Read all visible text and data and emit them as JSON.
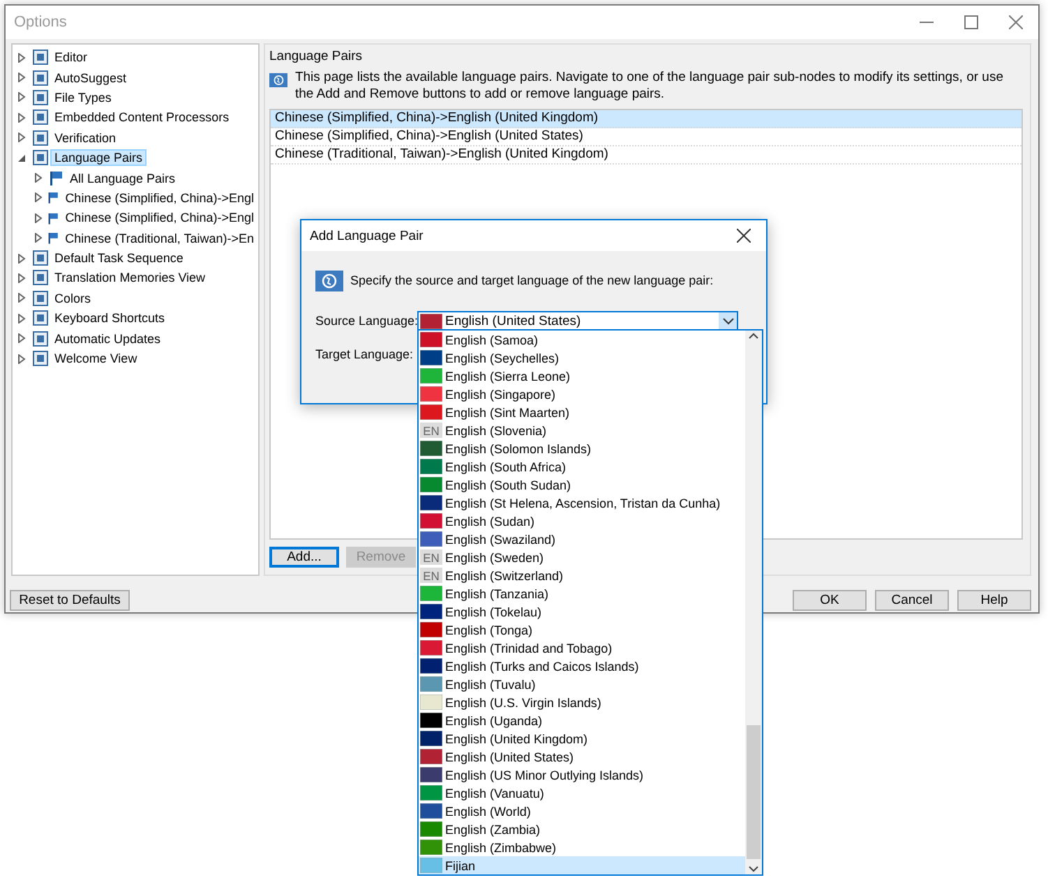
{
  "window": {
    "title": "Options"
  },
  "tree": [
    {
      "label": "Editor",
      "expanded": false,
      "selected": false
    },
    {
      "label": "AutoSuggest",
      "expanded": false,
      "selected": false
    },
    {
      "label": "File Types",
      "expanded": false,
      "selected": false
    },
    {
      "label": "Embedded Content Processors",
      "expanded": false,
      "selected": false
    },
    {
      "label": "Verification",
      "expanded": false,
      "selected": false
    },
    {
      "label": "Language Pairs",
      "expanded": true,
      "selected": true,
      "children": [
        {
          "label": "All Language Pairs",
          "expanded": false,
          "selected": false
        },
        {
          "label": "Chinese (Simplified, China)->Engl",
          "expanded": false,
          "selected": false
        },
        {
          "label": "Chinese (Simplified, China)->Engl",
          "expanded": false,
          "selected": false
        },
        {
          "label": "Chinese (Traditional, Taiwan)->En",
          "expanded": false,
          "selected": false
        }
      ]
    },
    {
      "label": "Default Task Sequence",
      "expanded": false,
      "selected": false
    },
    {
      "label": "Translation Memories View",
      "expanded": false,
      "selected": false
    },
    {
      "label": "Colors",
      "expanded": false,
      "selected": false
    },
    {
      "label": "Keyboard Shortcuts",
      "expanded": false,
      "selected": false
    },
    {
      "label": "Automatic Updates",
      "expanded": false,
      "selected": false
    },
    {
      "label": "Welcome View",
      "expanded": false,
      "selected": false
    }
  ],
  "page": {
    "heading": "Language Pairs",
    "description": "This page lists the available language pairs. Navigate to one of the language pair sub-nodes to modify its settings, or use the Add and Remove buttons to add or remove language pairs.",
    "pairs": [
      {
        "label": "Chinese (Simplified, China)->English (United Kingdom)",
        "selected": true
      },
      {
        "label": "Chinese (Simplified, China)->English (United States)",
        "selected": false
      },
      {
        "label": "Chinese (Traditional, Taiwan)->English (United Kingdom)",
        "selected": false
      }
    ],
    "buttons": [
      {
        "label": "Add...",
        "disabled": false,
        "focused": true
      },
      {
        "label": "Remove",
        "disabled": true,
        "focused": false
      }
    ]
  },
  "footer": {
    "reset": "Reset to Defaults",
    "buttons": [
      "OK",
      "Cancel",
      "Help"
    ]
  },
  "dialog": {
    "title": "Add Language Pair",
    "description": "Specify the source and target language of the new language pair:",
    "source_label": "Source Language:",
    "source_value": "English (United States)",
    "target_label": "Target Language:",
    "options": [
      {
        "label": "English (Samoa)",
        "kind": "flag",
        "color": "#ce1126",
        "selected": false
      },
      {
        "label": "English (Seychelles)",
        "kind": "flag",
        "color": "#003f87",
        "selected": false
      },
      {
        "label": "English (Sierra Leone)",
        "kind": "flag",
        "color": "#1eb53a",
        "selected": false
      },
      {
        "label": "English (Singapore)",
        "kind": "flag",
        "color": "#ef3340",
        "selected": false
      },
      {
        "label": "English (Sint Maarten)",
        "kind": "flag",
        "color": "#dc171d",
        "selected": false
      },
      {
        "label": "English (Slovenia)",
        "kind": "badge",
        "badge": "EN",
        "selected": false
      },
      {
        "label": "English (Solomon Islands)",
        "kind": "flag",
        "color": "#215b33",
        "selected": false
      },
      {
        "label": "English (South Africa)",
        "kind": "flag",
        "color": "#007a4d",
        "selected": false
      },
      {
        "label": "English (South Sudan)",
        "kind": "flag",
        "color": "#078930",
        "selected": false
      },
      {
        "label": "English (St Helena, Ascension, Tristan da Cunha)",
        "kind": "flag",
        "color": "#0a2b7a",
        "selected": false
      },
      {
        "label": "English (Sudan)",
        "kind": "flag",
        "color": "#d21034",
        "selected": false
      },
      {
        "label": "English (Swaziland)",
        "kind": "flag",
        "color": "#3e5eb9",
        "selected": false
      },
      {
        "label": "English (Sweden)",
        "kind": "badge",
        "badge": "EN",
        "selected": false
      },
      {
        "label": "English (Switzerland)",
        "kind": "badge",
        "badge": "EN",
        "selected": false
      },
      {
        "label": "English (Tanzania)",
        "kind": "flag",
        "color": "#1eb53b",
        "selected": false
      },
      {
        "label": "English (Tokelau)",
        "kind": "flag",
        "color": "#00247d",
        "selected": false
      },
      {
        "label": "English (Tonga)",
        "kind": "flag",
        "color": "#c10000",
        "selected": false
      },
      {
        "label": "English (Trinidad and Tobago)",
        "kind": "flag",
        "color": "#da1a35",
        "selected": false
      },
      {
        "label": "English (Turks and Caicos Islands)",
        "kind": "flag",
        "color": "#012070",
        "selected": false
      },
      {
        "label": "English (Tuvalu)",
        "kind": "flag",
        "color": "#5b97b1",
        "selected": false
      },
      {
        "label": "English (U.S. Virgin Islands)",
        "kind": "flag",
        "color": "#e8e8d0",
        "selected": false
      },
      {
        "label": "English (Uganda)",
        "kind": "flag",
        "color": "#000000",
        "selected": false
      },
      {
        "label": "English (United Kingdom)",
        "kind": "flag",
        "color": "#012169",
        "selected": false
      },
      {
        "label": "English (United States)",
        "kind": "flag",
        "color": "#b22235",
        "selected": false
      },
      {
        "label": "English (US Minor Outlying Islands)",
        "kind": "flag",
        "color": "#3c3b6e",
        "selected": false
      },
      {
        "label": "English (Vanuatu)",
        "kind": "flag",
        "color": "#009543",
        "selected": false
      },
      {
        "label": "English (World)",
        "kind": "flag",
        "color": "#1f4e9c",
        "selected": false
      },
      {
        "label": "English (Zambia)",
        "kind": "flag",
        "color": "#198a00",
        "selected": false
      },
      {
        "label": "English (Zimbabwe)",
        "kind": "flag",
        "color": "#319208",
        "selected": false
      },
      {
        "label": "Fijian",
        "kind": "flag",
        "color": "#68bfe5",
        "selected": true
      }
    ]
  }
}
